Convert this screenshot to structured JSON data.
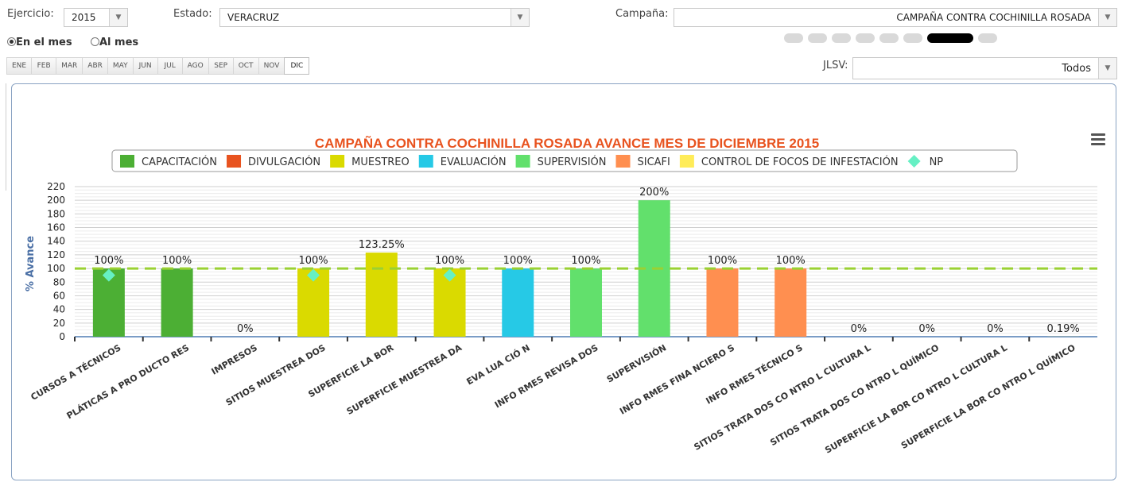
{
  "filters": {
    "ejercicio_label": "Ejercicio:",
    "ejercicio_value": "2015",
    "estado_label": "Estado:",
    "estado_value": "VERACRUZ",
    "campana_label": "Campaña:",
    "campana_value": "CAMPAÑA CONTRA COCHINILLA ROSADA",
    "jlsv_label": "JLSV:",
    "jlsv_value": "Todos"
  },
  "period": {
    "option_mes": "En el mes",
    "option_al_mes": "Al mes",
    "selected": "En el mes"
  },
  "months": [
    "ENE",
    "FEB",
    "MAR",
    "ABR",
    "MAY",
    "JUN",
    "JUL",
    "AGO",
    "SEP",
    "OCT",
    "NOV",
    "DIC"
  ],
  "active_month": "DIC",
  "pager": {
    "count": 8,
    "active_index": 6
  },
  "colors": {
    "capacitacion": "#4caf34",
    "divulgacion": "#e8531f",
    "muestreo": "#dada00",
    "evaluacion": "#26c9e6",
    "supervision": "#62e06c",
    "sicafi": "#ff8f50",
    "control": "#ffec58",
    "np": "#66f0c4",
    "title": "#e8531f",
    "reference": "#9ad133"
  },
  "chart_data": {
    "type": "bar",
    "title": "CAMPAÑA CONTRA COCHINILLA ROSADA AVANCE MES DE DICIEMBRE 2015",
    "ylabel": "% Avance",
    "xlabel": "",
    "ylim": [
      0,
      220
    ],
    "yticks": [
      0,
      20,
      40,
      60,
      80,
      100,
      120,
      140,
      160,
      180,
      200,
      220
    ],
    "reference_line": 100,
    "grid": true,
    "legend_position": "top",
    "legend": [
      {
        "name": "CAPACITACIÓN",
        "color": "#4caf34",
        "symbol": "square"
      },
      {
        "name": "DIVULGACIÓN",
        "color": "#e8531f",
        "symbol": "square"
      },
      {
        "name": "MUESTREO",
        "color": "#dada00",
        "symbol": "square"
      },
      {
        "name": "EVALUACIÓN",
        "color": "#26c9e6",
        "symbol": "square"
      },
      {
        "name": "SUPERVISIÓN",
        "color": "#62e06c",
        "symbol": "square"
      },
      {
        "name": "SICAFI",
        "color": "#ff8f50",
        "symbol": "square"
      },
      {
        "name": "CONTROL DE FOCOS DE INFESTACIÓN",
        "color": "#ffec58",
        "symbol": "square"
      },
      {
        "name": "NP",
        "color": "#66f0c4",
        "symbol": "diamond"
      }
    ],
    "categories": [
      "CURSOS A TÉCNICOS",
      "PLÁTICAS A PRO DUCTO RES",
      "IMPRESOS",
      "SITIOS MUESTREA DOS",
      "SUPERFICIE LA BOR",
      "SUPERFICIE MUESTREA DA",
      "EVA LUA CIÓ N",
      "INFO RMES REVISA DOS",
      "SUPERVISIÓN",
      "INFO RMES FINA NCIERO S",
      "INFO RMES TÉCNICO S",
      "SITIOS TRATA DOS CO NTRO L CULTURA L",
      "SITIOS TRATA DOS CO NTRO L QUÍMICO",
      "SUPERFICIE LA BOR CO NTRO L CULTURA L",
      "SUPERFICIE LA BOR CO NTRO L QUÍMICO"
    ],
    "values": [
      100,
      100,
      0,
      100,
      123.25,
      100,
      100,
      100,
      200,
      100,
      100,
      0,
      0,
      0,
      0.19
    ],
    "data_labels": [
      "100%",
      "100%",
      "0%",
      "100%",
      "123.25%",
      "100%",
      "100%",
      "100%",
      "200%",
      "100%",
      "100%",
      "0%",
      "0%",
      "0%",
      "0.19%"
    ],
    "groups": [
      "CAPACITACIÓN",
      "CAPACITACIÓN",
      "DIVULGACIÓN",
      "MUESTREO",
      "MUESTREO",
      "MUESTREO",
      "EVALUACIÓN",
      "SUPERVISIÓN",
      "SUPERVISIÓN",
      "SICAFI",
      "SICAFI",
      "CONTROL DE FOCOS DE INFESTACIÓN",
      "CONTROL DE FOCOS DE INFESTACIÓN",
      "CONTROL DE FOCOS DE INFESTACIÓN",
      "CONTROL DE FOCOS DE INFESTACIÓN"
    ],
    "np_points": [
      {
        "category": "CURSOS A TÉCNICOS",
        "value": 90
      },
      {
        "category": "SITIOS MUESTREA DOS",
        "value": 90
      },
      {
        "category": "SUPERFICIE MUESTREA DA",
        "value": 90
      }
    ]
  }
}
